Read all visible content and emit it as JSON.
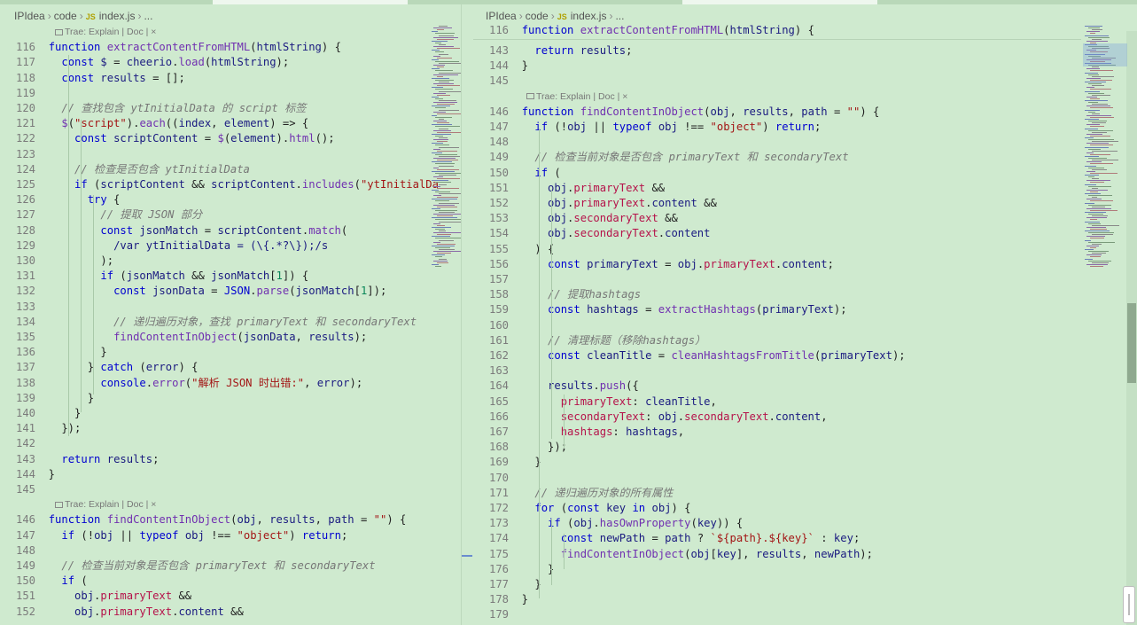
{
  "left": {
    "breadcrumb": {
      "root": "IPIdea",
      "folder": "code",
      "js_badge": "JS",
      "file": "index.js",
      "tail": "..."
    },
    "codelens": [
      {
        "text": "Trae: Explain | Doc | ×",
        "before_line": "116"
      },
      {
        "text": "Trae: Explain | Doc | ×",
        "before_line": "146"
      }
    ]
  },
  "right": {
    "breadcrumb": {
      "root": "IPIdea",
      "folder": "code",
      "js_badge": "JS",
      "file": "index.js",
      "tail": "..."
    },
    "codelens": [
      {
        "text": "Trae: Explain | Doc | ×",
        "before_line": "146"
      }
    ]
  },
  "code": {
    "lines": {
      "116": "function extractContentFromHTML(htmlString) {",
      "117": "  const $ = cheerio.load(htmlString);",
      "118": "  const results = [];",
      "119": "",
      "120": "  // 查找包含 ytInitialData 的 script 标签",
      "121": "  $(\"script\").each((index, element) => {",
      "122": "    const scriptContent = $(element).html();",
      "123": "",
      "124": "    // 检查是否包含 ytInitialData",
      "125": "    if (scriptContent && scriptContent.includes(\"ytInitialDa",
      "126": "      try {",
      "127": "        // 提取 JSON 部分",
      "128": "        const jsonMatch = scriptContent.match(",
      "129": "          /var ytInitialData = (\\{.*?\\});/s",
      "130": "        );",
      "131": "        if (jsonMatch && jsonMatch[1]) {",
      "132": "          const jsonData = JSON.parse(jsonMatch[1]);",
      "133": "",
      "134": "          // 递归遍历对象，查找 primaryText 和 secondaryText",
      "135": "          findContentInObject(jsonData, results);",
      "136": "        }",
      "137": "      } catch (error) {",
      "138": "        console.error(\"解析 JSON 时出错:\", error);",
      "139": "      }",
      "140": "    }",
      "141": "  });",
      "142": "",
      "143": "  return results;",
      "144": "}",
      "145": "",
      "146": "function findContentInObject(obj, results, path = \"\") {",
      "147": "  if (!obj || typeof obj !== \"object\") return;",
      "148": "",
      "149": "  // 检查当前对象是否包含 primaryText 和 secondaryText",
      "150": "  if (",
      "151": "    obj.primaryText &&",
      "152": "    obj.primaryText.content &&",
      "153": "    obj.secondaryText &&",
      "154": "    obj.secondaryText.content",
      "155": "  ) {",
      "156": "    const primaryText = obj.primaryText.content;",
      "157": "",
      "158": "    // 提取hashtags",
      "159": "    const hashtags = extractHashtags(primaryText);",
      "160": "",
      "161": "    // 清理标题（移除hashtags）",
      "162": "    const cleanTitle = cleanHashtagsFromTitle(primaryText);",
      "163": "",
      "164": "    results.push({",
      "165": "      primaryText: cleanTitle,",
      "166": "      secondaryText: obj.secondaryText.content,",
      "167": "      hashtags: hashtags,",
      "168": "    });",
      "169": "  }",
      "170": "",
      "171": "  // 递归遍历对象的所有属性",
      "172": "  for (const key in obj) {",
      "173": "    if (obj.hasOwnProperty(key)) {",
      "174": "      const newPath = path ? `${path}.${key}` : key;",
      "175": "      findContentInObject(obj[key], results, newPath);",
      "176": "    }",
      "177": "  }",
      "178": "}",
      "179": ""
    },
    "left_visible": [
      "116",
      "117",
      "118",
      "119",
      "120",
      "121",
      "122",
      "123",
      "124",
      "125",
      "126",
      "127",
      "128",
      "129",
      "130",
      "131",
      "132",
      "133",
      "134",
      "135",
      "136",
      "137",
      "138",
      "139",
      "140",
      "141",
      "142",
      "143",
      "144",
      "145",
      "146",
      "147",
      "148",
      "149",
      "150",
      "151",
      "152"
    ],
    "right_sticky": "116",
    "right_visible": [
      "143",
      "144",
      "145",
      "146",
      "147",
      "148",
      "149",
      "150",
      "151",
      "152",
      "153",
      "154",
      "155",
      "156",
      "157",
      "158",
      "159",
      "160",
      "161",
      "162",
      "163",
      "164",
      "165",
      "166",
      "167",
      "168",
      "169",
      "170",
      "171",
      "172",
      "173",
      "174",
      "175",
      "176",
      "177",
      "178",
      "179"
    ]
  },
  "colors": {
    "background": "#cfeacf",
    "keyword": "#0000d0",
    "function": "#7030b0",
    "string": "#a31515",
    "comment": "#777777",
    "property": "#b5124a"
  }
}
